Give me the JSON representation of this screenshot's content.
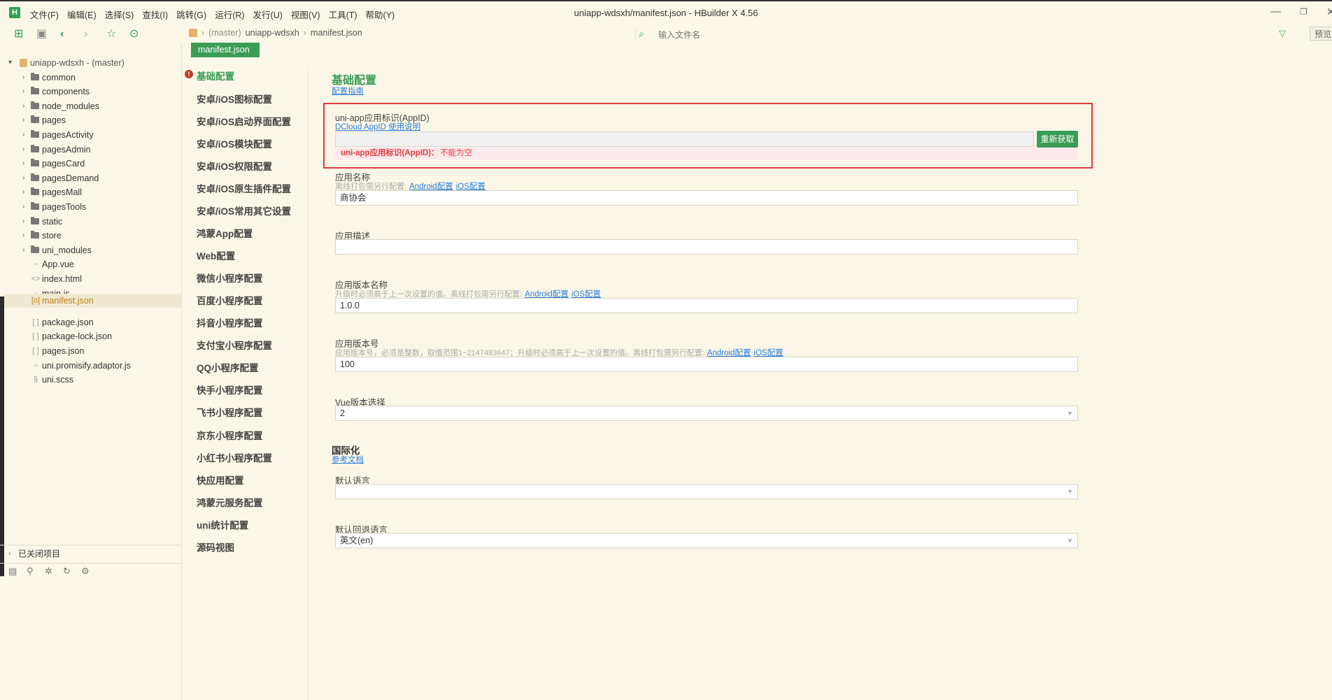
{
  "app": {
    "window_title": "uniapp-wdsxh/manifest.json - HBuilder X 4.56",
    "logo_letter": "H",
    "menu": [
      "文件(F)",
      "编辑(E)",
      "选择(S)",
      "查找(I)",
      "跳转(G)",
      "运行(R)",
      "发行(U)",
      "视图(V)",
      "工具(T)",
      "帮助(Y)"
    ]
  },
  "toolbar": {
    "breadcrumb": {
      "branch": "(master)",
      "project": "uniapp-wdsxh",
      "file": "manifest.json"
    },
    "file_search_placeholder": "输入文件名",
    "preview_label": "预览"
  },
  "project_tree": {
    "root_label": "uniapp-wdsxh - (master)",
    "items": [
      {
        "label": "common",
        "type": "folder"
      },
      {
        "label": "components",
        "type": "folder"
      },
      {
        "label": "node_modules",
        "type": "folder"
      },
      {
        "label": "pages",
        "type": "folder"
      },
      {
        "label": "pagesActivity",
        "type": "folder"
      },
      {
        "label": "pagesAdmin",
        "type": "folder"
      },
      {
        "label": "pagesCard",
        "type": "folder"
      },
      {
        "label": "pagesDemand",
        "type": "folder"
      },
      {
        "label": "pagesMall",
        "type": "folder"
      },
      {
        "label": "pagesTools",
        "type": "folder"
      },
      {
        "label": "static",
        "type": "folder"
      },
      {
        "label": "store",
        "type": "folder"
      },
      {
        "label": "uni_modules",
        "type": "folder"
      },
      {
        "label": "App.vue",
        "type": "file"
      },
      {
        "label": "index.html",
        "type": "file"
      },
      {
        "label": "main.js",
        "type": "file"
      },
      {
        "label": "manifest.json",
        "type": "file",
        "selected": true
      },
      {
        "label": "package.json",
        "type": "file"
      },
      {
        "label": "package-lock.json",
        "type": "file"
      },
      {
        "label": "pages.json",
        "type": "file"
      },
      {
        "label": "uni.promisify.adaptor.js",
        "type": "file"
      },
      {
        "label": "uni.scss",
        "type": "file"
      }
    ],
    "closed_projects_label": "已关闭项目"
  },
  "editor_tab": {
    "label": "manifest.json"
  },
  "nav": {
    "items": [
      "基础配置",
      "安卓/iOS图标配置",
      "安卓/iOS启动界面配置",
      "安卓/iOS模块配置",
      "安卓/iOS权限配置",
      "安卓/iOS原生插件配置",
      "安卓/iOS常用其它设置",
      "鸿蒙App配置",
      "Web配置",
      "微信小程序配置",
      "百度小程序配置",
      "抖音小程序配置",
      "支付宝小程序配置",
      "QQ小程序配置",
      "快手小程序配置",
      "飞书小程序配置",
      "京东小程序配置",
      "小红书小程序配置",
      "快应用配置",
      "鸿蒙元服务配置",
      "uni统计配置",
      "源码视图"
    ]
  },
  "form": {
    "section_basic": "基础配置",
    "guide_link": "配置指南",
    "appid": {
      "label": "uni-app应用标识(AppID)",
      "help_link": "DCloud AppID 使用说明",
      "value": "",
      "refetch_button": "重新获取",
      "error_field": "uni-app应用标识(AppID)：",
      "error_text": "不能为空"
    },
    "app_name": {
      "label": "应用名称",
      "hint": "离线打包需另行配置:",
      "android_link": "Android配置",
      "ios_link": "iOS配置",
      "value": "商协会"
    },
    "app_desc": {
      "label": "应用描述",
      "value": ""
    },
    "version_name": {
      "label": "应用版本名称",
      "hint": "升级时必须高于上一次设置的值。离线打包需另行配置:",
      "android_link": "Android配置",
      "ios_link": "iOS配置",
      "value": "1.0.0"
    },
    "version_code": {
      "label": "应用版本号",
      "hint": "应用版本号，必须是整数，取值范围1~2147483647；升级时必须高于上一次设置的值。离线打包需另行配置:",
      "android_link": "Android配置",
      "ios_link": "iOS配置",
      "value": "100"
    },
    "vue_version": {
      "label": "Vue版本选择",
      "value": "2"
    },
    "section_i18n": "国际化",
    "i18n_link": "参考文档",
    "default_locale": {
      "label": "默认语言",
      "value": ""
    },
    "fallback_locale": {
      "label": "默认回退语言",
      "value": "英文(en)"
    }
  },
  "colors": {
    "accent": "#3a9d55",
    "error": "#e23b3b",
    "background": "#fbf7e8"
  }
}
